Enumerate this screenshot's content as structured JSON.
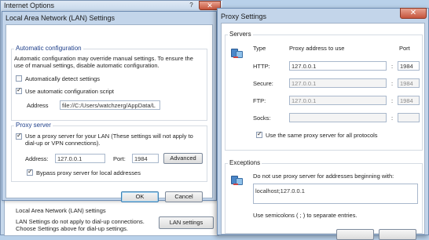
{
  "internet_options": {
    "title": "Internet Options",
    "help_glyph": "?",
    "close_glyph": "✕",
    "lan_group_title": "Local Area Network (LAN) settings",
    "lan_group_text1": "LAN Settings do not apply to dial-up connections.",
    "lan_group_text2": "Choose Settings above for dial-up settings.",
    "lan_settings_button": "LAN settings"
  },
  "lan_dialog": {
    "title": "Local Area Network (LAN) Settings",
    "auto_config": {
      "group_label": "Automatic configuration",
      "description1": "Automatic configuration may override manual settings. To ensure the",
      "description2": "use of manual settings, disable automatic configuration.",
      "detect_label": "Automatically detect settings",
      "detect_checked": false,
      "script_label": "Use automatic configuration script",
      "script_checked": true,
      "address_label": "Address",
      "address_value": "file://C:/Users/watchzerg/AppData/L"
    },
    "proxy": {
      "group_label": "Proxy server",
      "use_proxy_label1": "Use a proxy server for your LAN (These settings will not apply to",
      "use_proxy_label2": "dial-up or VPN connections).",
      "use_proxy_checked": true,
      "address_label": "Address:",
      "address_value": "127.0.0.1",
      "port_label": "Port:",
      "port_value": "1984",
      "advanced_button": "Advanced",
      "bypass_label": "Bypass proxy server for local addresses",
      "bypass_checked": true
    },
    "ok_button": "OK",
    "cancel_button": "Cancel"
  },
  "proxy_dialog": {
    "title": "Proxy Settings",
    "close_glyph": "✕",
    "servers": {
      "group_label": "Servers",
      "type_header": "Type",
      "address_header": "Proxy address to use",
      "port_header": "Port",
      "rows": [
        {
          "label": "HTTP:",
          "address": "127.0.0.1",
          "port": "1984",
          "enabled": true
        },
        {
          "label": "Secure:",
          "address": "127.0.0.1",
          "port": "1984",
          "enabled": false
        },
        {
          "label": "FTP:",
          "address": "127.0.0.1",
          "port": "1984",
          "enabled": false
        },
        {
          "label": "Socks:",
          "address": "",
          "port": "",
          "enabled": false
        }
      ],
      "colon": ":",
      "same_proxy_label": "Use the same proxy server for all protocols",
      "same_proxy_checked": true
    },
    "exceptions": {
      "group_label": "Exceptions",
      "description": "Do not use proxy server for addresses beginning with:",
      "value": "localhost;127.0.0.1",
      "hint": "Use semicolons ( ; ) to separate entries."
    }
  },
  "colors": {
    "desktop": "#b9d1ea",
    "window_frame": "#c3d5ea",
    "group_label": "#1e3f8a",
    "close_button": "#c5543b"
  }
}
